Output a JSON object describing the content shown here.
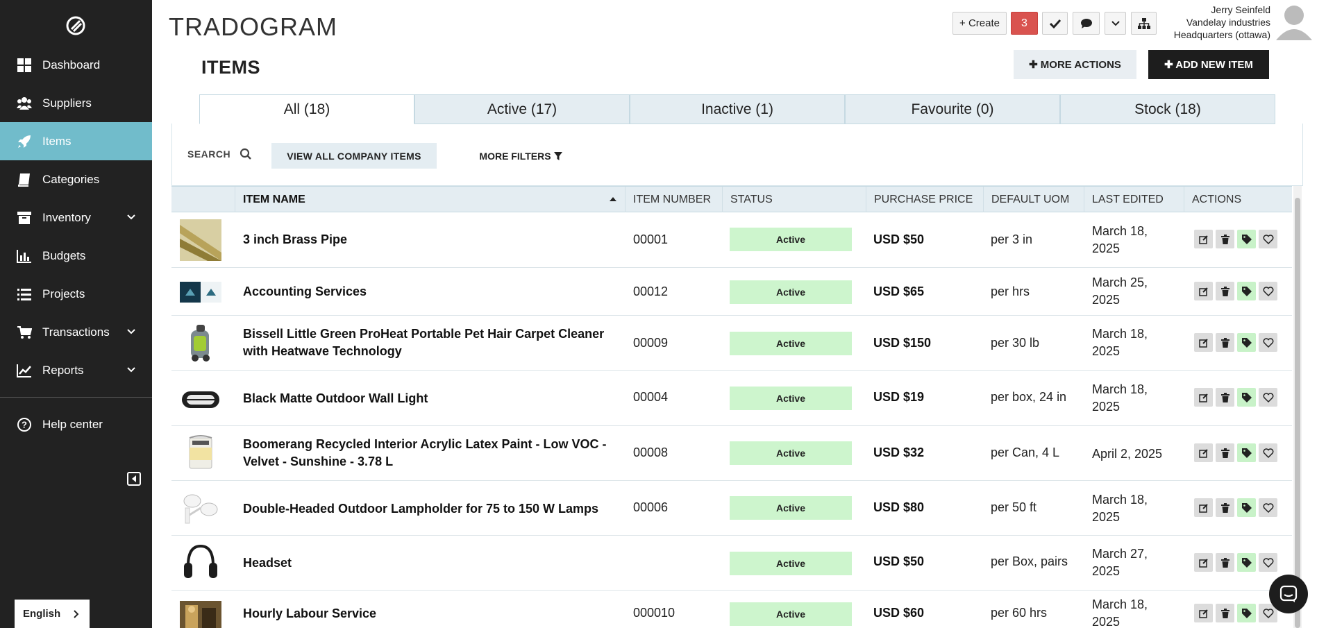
{
  "sidebar": {
    "items": [
      {
        "label": "Dashboard",
        "icon": "dashboard-icon"
      },
      {
        "label": "Suppliers",
        "icon": "users-icon"
      },
      {
        "label": "Items",
        "icon": "rocket-icon",
        "active": true
      },
      {
        "label": "Categories",
        "icon": "book-icon"
      },
      {
        "label": "Inventory",
        "icon": "box-icon",
        "expandable": true
      },
      {
        "label": "Budgets",
        "icon": "bar-chart-icon"
      },
      {
        "label": "Projects",
        "icon": "list-icon"
      },
      {
        "label": "Transactions",
        "icon": "cart-icon",
        "expandable": true
      },
      {
        "label": "Reports",
        "icon": "line-chart-icon",
        "expandable": true
      }
    ],
    "help": "Help center",
    "language": "English"
  },
  "header": {
    "brand": "TRADOGRAM",
    "create_label": "+ Create",
    "notification_count": "3",
    "user_name": "Jerry Seinfeld",
    "company": "Vandelay industries",
    "location": "Headquarters (ottawa)"
  },
  "page": {
    "title": "ITEMS",
    "more_actions": "✚ MORE ACTIONS",
    "add_new": "✚ ADD NEW ITEM"
  },
  "tabs": [
    "All (18)",
    "Active (17)",
    "Inactive (1)",
    "Favourite (0)",
    "Stock (18)"
  ],
  "filters": {
    "search_label": "SEARCH",
    "view_all": "VIEW ALL COMPANY ITEMS",
    "more_filters": "MORE FILTERS"
  },
  "table": {
    "columns": [
      "ITEM NAME",
      "ITEM NUMBER",
      "STATUS",
      "PURCHASE PRICE",
      "DEFAULT UOM",
      "LAST EDITED",
      "ACTIONS"
    ],
    "rows": [
      {
        "name": "3 inch Brass Pipe",
        "number": "00001",
        "status": "Active",
        "price": "USD $50",
        "uom": "per 3 in",
        "edited": "March 18, 2025"
      },
      {
        "name": "Accounting Services",
        "number": "00012",
        "status": "Active",
        "price": "USD $65",
        "uom": "per hrs",
        "edited": "March 25, 2025"
      },
      {
        "name": "Bissell Little Green ProHeat Portable Pet Hair Carpet Cleaner with Heatwave Technology",
        "number": "00009",
        "status": "Active",
        "price": "USD $150",
        "uom": "per 30 lb",
        "edited": "March 18, 2025"
      },
      {
        "name": "Black Matte Outdoor Wall Light",
        "number": "00004",
        "status": "Active",
        "price": "USD $19",
        "uom": "per box, 24 in",
        "edited": "March 18, 2025"
      },
      {
        "name": "Boomerang Recycled Interior Acrylic Latex Paint - Low VOC - Velvet - Sunshine - 3.78 L",
        "number": "00008",
        "status": "Active",
        "price": "USD $32",
        "uom": "per Can, 4 L",
        "edited": "April 2, 2025"
      },
      {
        "name": "Double-Headed Outdoor Lampholder for 75 to 150 W Lamps",
        "number": "00006",
        "status": "Active",
        "price": "USD $80",
        "uom": "per 50 ft",
        "edited": "March 18, 2025"
      },
      {
        "name": "Headset",
        "number": "",
        "status": "Active",
        "price": "USD $50",
        "uom": "per Box, pairs",
        "edited": "March 27, 2025"
      },
      {
        "name": "Hourly Labour Service",
        "number": "000010",
        "status": "Active",
        "price": "USD $60",
        "uom": "per 60 hrs",
        "edited": "March 18, 2025"
      }
    ]
  },
  "colors": {
    "accent": "#71bccb",
    "sidebar": "#222222",
    "status_active": "#cdf5cd",
    "badge_red": "#d9534f"
  }
}
